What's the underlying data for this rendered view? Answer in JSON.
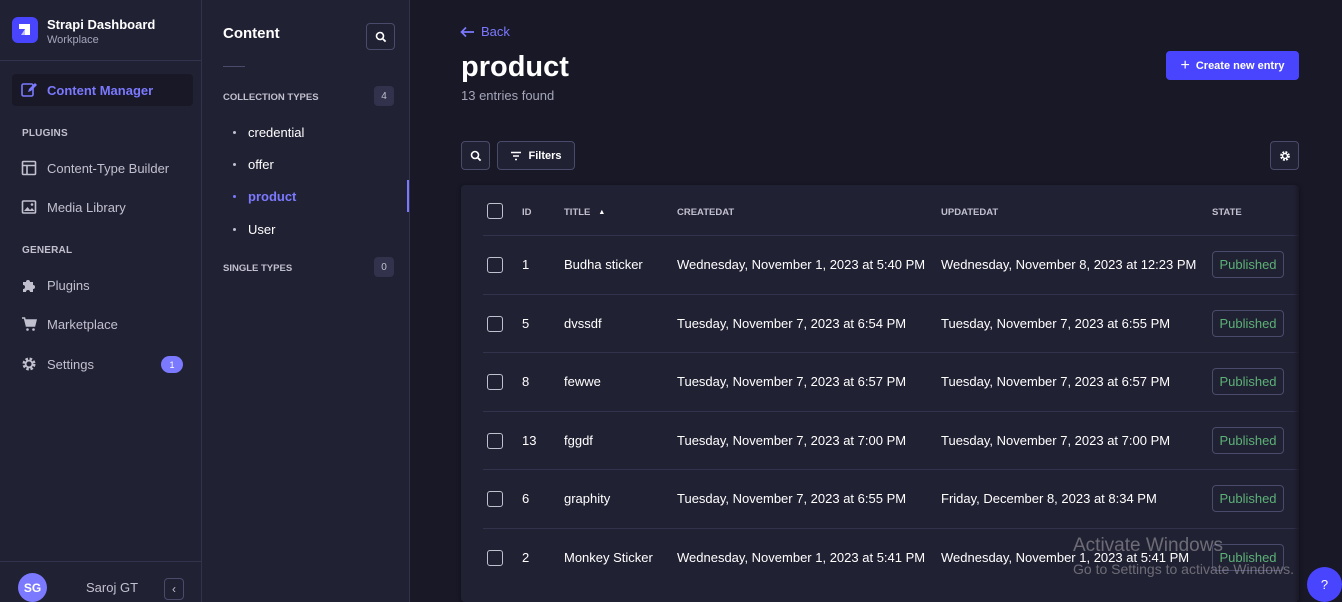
{
  "brand": {
    "title": "Strapi Dashboard",
    "subtitle": "Workplace"
  },
  "main_nav": {
    "content_manager": "Content Manager",
    "plugins_section": "PLUGINS",
    "content_type_builder": "Content-Type Builder",
    "media_library": "Media Library",
    "general_section": "GENERAL",
    "plugins": "Plugins",
    "marketplace": "Marketplace",
    "settings": "Settings",
    "settings_badge": "1"
  },
  "user": {
    "initials": "SG",
    "name": "Saroj GT"
  },
  "sub_nav": {
    "title": "Content",
    "collection_types_label": "COLLECTION TYPES",
    "collection_types_count": "4",
    "collection_types": [
      "credential",
      "offer",
      "product",
      "User"
    ],
    "active": "product",
    "single_types_label": "SINGLE TYPES",
    "single_types_count": "0"
  },
  "header": {
    "back": "Back",
    "title": "product",
    "subtitle": "13 entries found",
    "create_button": "Create new entry"
  },
  "toolbar": {
    "filters": "Filters"
  },
  "table": {
    "columns": {
      "id": "ID",
      "title": "TITLE",
      "createdAt": "CREATEDAT",
      "updatedAt": "UPDATEDAT",
      "state": "STATE"
    },
    "sort": {
      "column": "title",
      "direction": "ascending"
    },
    "rows": [
      {
        "id": "1",
        "title": "Budha sticker",
        "createdAt": "Wednesday, November 1, 2023 at 5:40 PM",
        "updatedAt": "Wednesday, November 8, 2023 at 12:23 PM",
        "state": "Published"
      },
      {
        "id": "5",
        "title": "dvssdf",
        "createdAt": "Tuesday, November 7, 2023 at 6:54 PM",
        "updatedAt": "Tuesday, November 7, 2023 at 6:55 PM",
        "state": "Published"
      },
      {
        "id": "8",
        "title": "fewwe",
        "createdAt": "Tuesday, November 7, 2023 at 6:57 PM",
        "updatedAt": "Tuesday, November 7, 2023 at 6:57 PM",
        "state": "Published"
      },
      {
        "id": "13",
        "title": "fggdf",
        "createdAt": "Tuesday, November 7, 2023 at 7:00 PM",
        "updatedAt": "Tuesday, November 7, 2023 at 7:00 PM",
        "state": "Published"
      },
      {
        "id": "6",
        "title": "graphity",
        "createdAt": "Tuesday, November 7, 2023 at 6:55 PM",
        "updatedAt": "Friday, December 8, 2023 at 8:34 PM",
        "state": "Published"
      },
      {
        "id": "2",
        "title": "Monkey Sticker",
        "createdAt": "Wednesday, November 1, 2023 at 5:41 PM",
        "updatedAt": "Wednesday, November 1, 2023 at 5:41 PM",
        "state": "Published"
      }
    ]
  },
  "watermark": {
    "line1": "Activate Windows",
    "line2": "Go to Settings to activate Windows."
  },
  "help": "?",
  "colors": {
    "accent": "#4945ff",
    "accent_light": "#7b79ff",
    "published": "#5cb176",
    "nav_bg": "#212134",
    "page_bg": "#181826"
  }
}
